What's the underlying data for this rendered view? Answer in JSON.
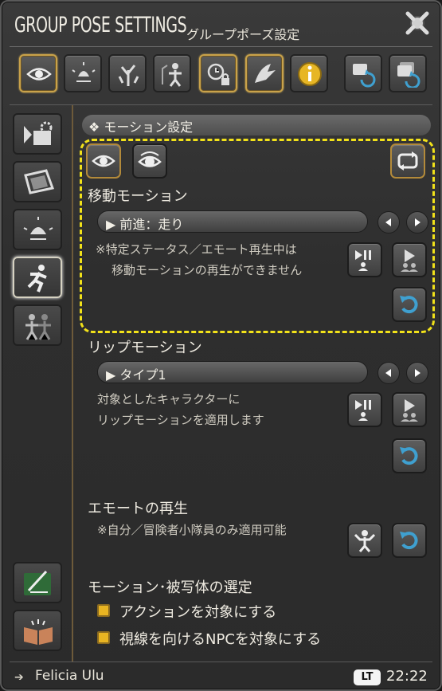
{
  "window": {
    "title": "GROUP POSE SETTINGS",
    "subtitle": "グループポーズ設定"
  },
  "toolbar": {
    "icons": [
      "eye-icon",
      "lamp-icon",
      "tree-icon",
      "person-icon",
      "clock-lock-icon",
      "bird-icon",
      "info-icon",
      "reset-icon",
      "reset-all-icon"
    ]
  },
  "sidebar": {
    "items": [
      "camera-settings",
      "frame",
      "lighting",
      "motion",
      "characters",
      "journal",
      "book"
    ]
  },
  "panel": {
    "section_title": "❖ モーション設定",
    "move": {
      "label": "移動モーション",
      "value": "前進：走り",
      "note_line1": "※特定ステータス／エモート再生中は",
      "note_line2": "移動モーションの再生ができません"
    },
    "lip": {
      "label": "リップモーション",
      "value": "タイプ1",
      "note_line1": "対象としたキャラクターに",
      "note_line2": "リップモーションを適用します"
    },
    "emote": {
      "label": "エモートの再生",
      "note": "※自分／冒険者小隊員のみ適用可能"
    },
    "target": {
      "label": "モーション･被写体の選定",
      "option1": "アクションを対象にする",
      "option2": "視線を向けるNPCを対象にする"
    }
  },
  "footer": {
    "name": "Felicia Ulu",
    "badge": "LT",
    "time": "22:22"
  },
  "colors": {
    "accent": "#c9a24a",
    "highlight": "#f2e21a",
    "checkbox": "#e8b422"
  }
}
